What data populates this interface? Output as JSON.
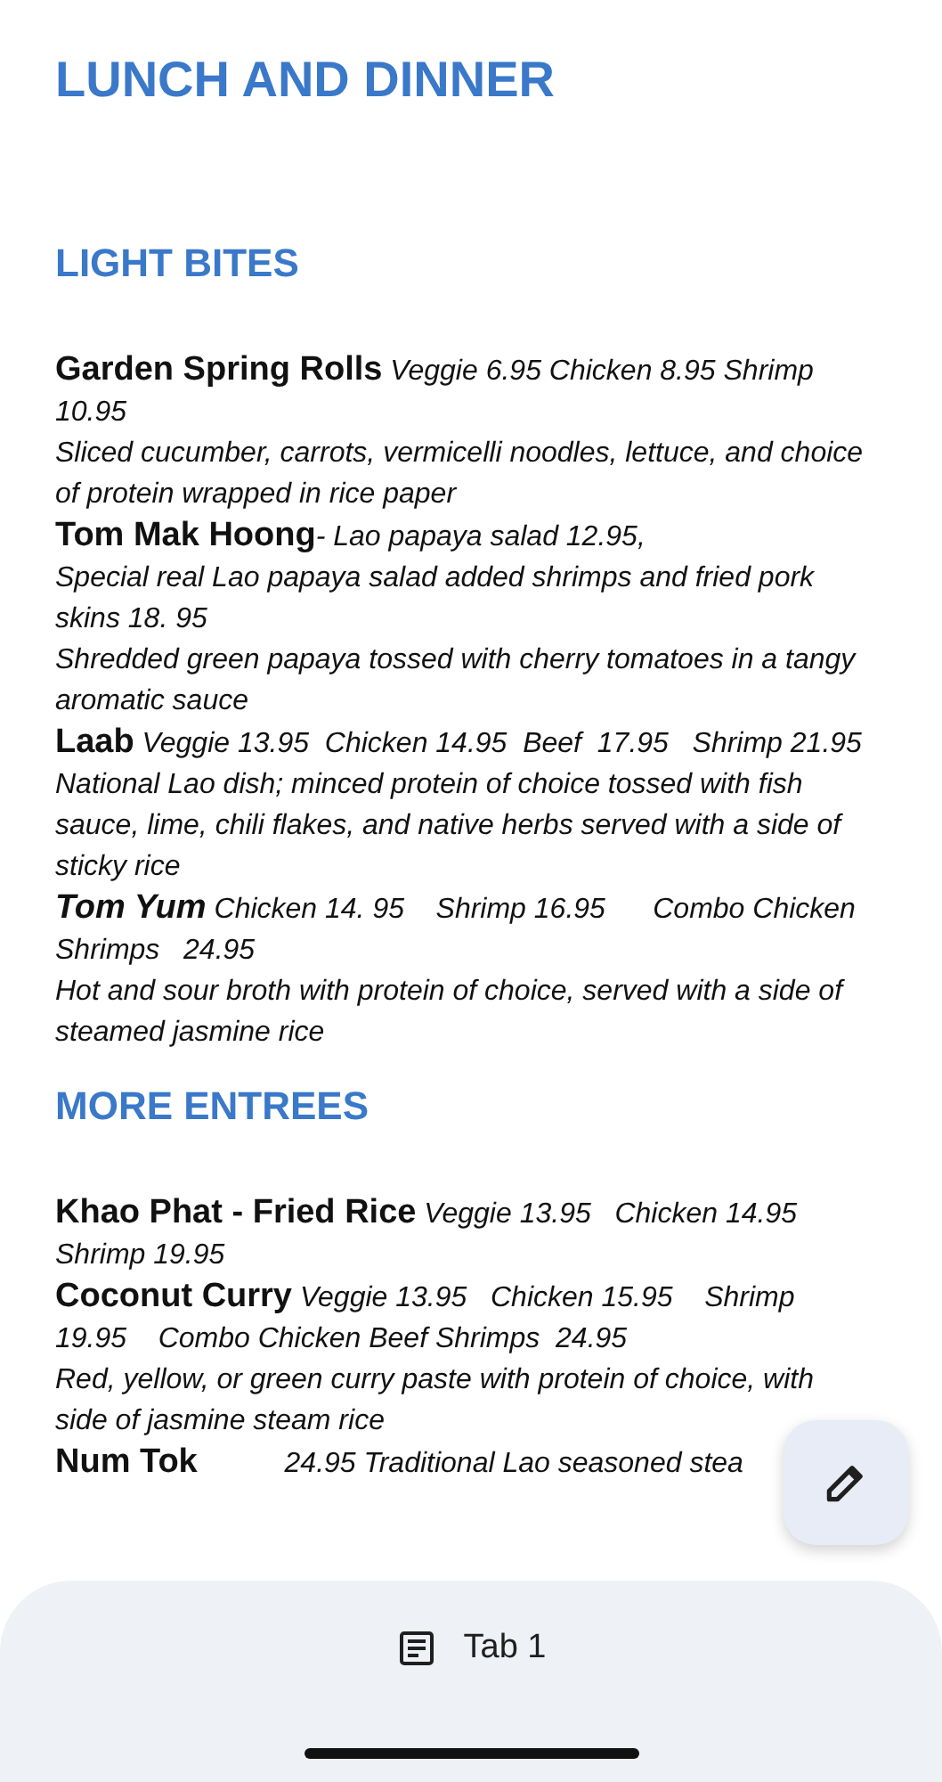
{
  "title": "LUNCH AND DINNER",
  "sections": [
    {
      "heading": "LIGHT BITES",
      "items": [
        {
          "text": "**Garden Spring Rolls** Veggie 6.95 Chicken 8.95 Shrimp 10.95",
          "name_italic": false,
          "details": [
            "Sliced cucumber, carrots, vermicelli noodles, lettuce, and choice of protein wrapped in rice paper"
          ]
        },
        {
          "text": "**Tom Mak Hoong**- Lao papaya salad 12.95,",
          "name_italic": false,
          "details": [
            "Special real Lao papaya salad added shrimps and fried pork skins 18. 95",
            "Shredded green papaya tossed with cherry tomatoes in a tangy aromatic sauce"
          ]
        },
        {
          "text": "**Laab** Veggie 13.95  Chicken 14.95  Beef  17.95   Shrimp 21.95",
          "name_italic": false,
          "details": [
            "National Lao dish; minced protein of choice tossed with fish sauce, lime, chili flakes, and native herbs served with a side of sticky rice"
          ]
        },
        {
          "text": "**Tom Yum** Chicken 14. 95    Shrimp 16.95      Combo Chicken  Shrimps   24.95",
          "name_italic": true,
          "details": [
            "Hot and sour broth with protein of choice, served with a side of steamed jasmine rice"
          ]
        }
      ]
    },
    {
      "heading": "MORE ENTREES",
      "items": [
        {
          "text": "**Khao Phat - Fried Rice** Veggie 13.95   Chicken 14.95 Shrimp 19.95",
          "name_italic": false
        },
        {
          "text": "**Coconut Curry** Veggie 13.95   Chicken 15.95    Shrimp 19.95    Combo Chicken Beef Shrimps  24.95",
          "name_italic": false,
          "details": [
            "Red, yellow, or green curry paste with protein of choice, with side of jasmine steam rice"
          ]
        },
        {
          "text": "**Num Tok**           24.95 Traditional Lao seasoned stea",
          "name_italic": false
        }
      ]
    }
  ],
  "tab": {
    "label": "Tab 1"
  }
}
